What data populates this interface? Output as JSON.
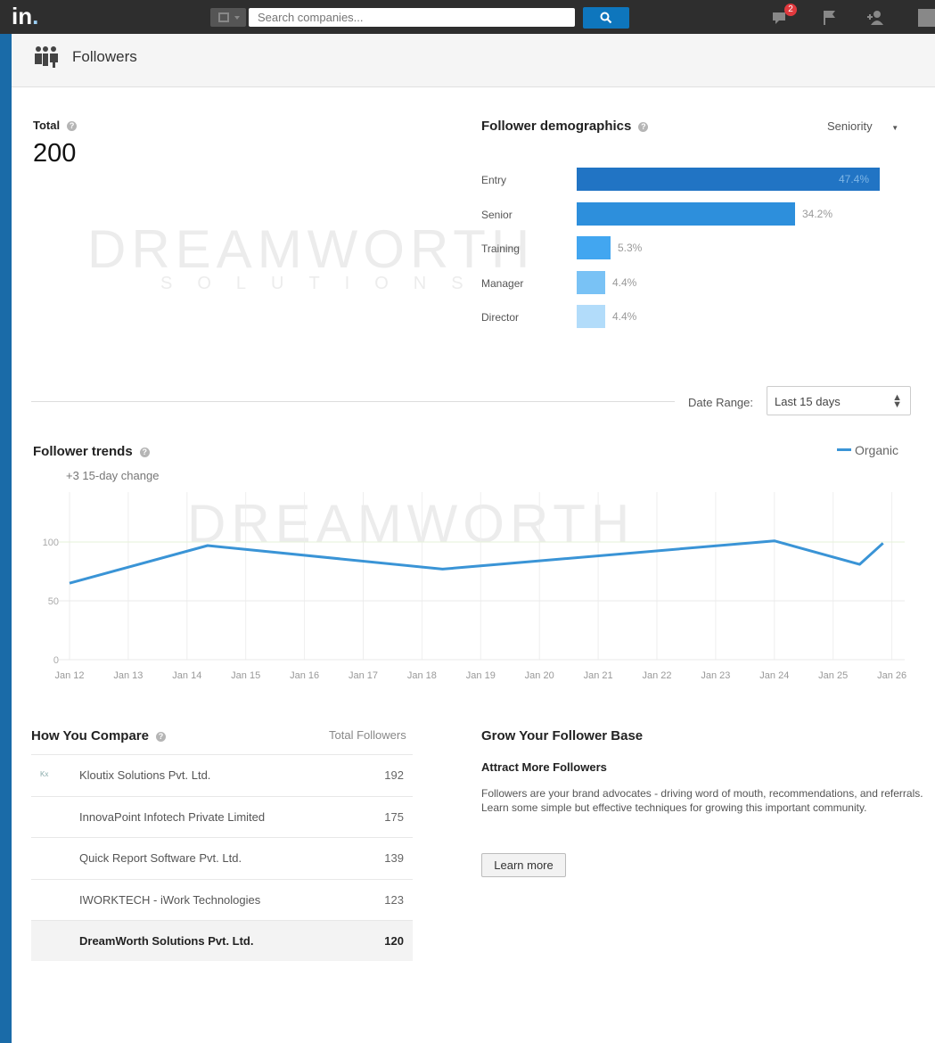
{
  "topbar": {
    "logo_text": "in",
    "search_placeholder": "Search companies...",
    "notification_count": "2"
  },
  "page": {
    "title": "Followers"
  },
  "watermark": {
    "brand": "DREAMWORTH",
    "tagline": "SOLUTIONS"
  },
  "total": {
    "label": "Total",
    "value": "200"
  },
  "demographics": {
    "title": "Follower demographics",
    "selected_filter": "Seniority",
    "rows": [
      {
        "label": "Entry",
        "value": 47.4,
        "display": "47.4%",
        "color": "#2174c4"
      },
      {
        "label": "Senior",
        "value": 34.2,
        "display": "34.2%",
        "color": "#2d8fdc"
      },
      {
        "label": "Training",
        "value": 5.3,
        "display": "5.3%",
        "color": "#42a6f0"
      },
      {
        "label": "Manager",
        "value": 4.4,
        "display": "4.4%",
        "color": "#79c2f5"
      },
      {
        "label": "Director",
        "value": 4.4,
        "display": "4.4%",
        "color": "#b2dcfa"
      }
    ]
  },
  "date_range": {
    "label": "Date Range:",
    "value": "Last 15 days"
  },
  "trends": {
    "title": "Follower trends",
    "change_note": "+3 15-day change",
    "legend_label": "Organic"
  },
  "chart_data": {
    "type": "line",
    "x": [
      "Jan 12",
      "Jan 13",
      "Jan 14",
      "Jan 15",
      "Jan 16",
      "Jan 17",
      "Jan 18",
      "Jan 19",
      "Jan 20",
      "Jan 21",
      "Jan 22",
      "Jan 23",
      "Jan 24",
      "Jan 25",
      "Jan 26"
    ],
    "yticks": [
      0,
      50,
      100
    ],
    "ylim": [
      0,
      110
    ],
    "series": [
      {
        "name": "Organic",
        "color": "#3a94d6",
        "points": [
          {
            "x": 12.0,
            "y": 65
          },
          {
            "x": 14.35,
            "y": 97
          },
          {
            "x": 18.35,
            "y": 77
          },
          {
            "x": 24.0,
            "y": 101
          },
          {
            "x": 25.45,
            "y": 81
          },
          {
            "x": 25.85,
            "y": 99
          }
        ]
      }
    ],
    "grid": true
  },
  "compare": {
    "title": "How You Compare",
    "column_header": "Total Followers",
    "rows": [
      {
        "name": "Kloutix Solutions Pvt. Ltd.",
        "count": "192",
        "logo_text": "Kx"
      },
      {
        "name": "InnovaPoint Infotech Private Limited",
        "count": "175",
        "logo_text": ""
      },
      {
        "name": "Quick Report Software Pvt. Ltd.",
        "count": "139",
        "logo_text": ""
      },
      {
        "name": "IWORKTECH - iWork Technologies",
        "count": "123",
        "logo_text": ""
      },
      {
        "name": "DreamWorth Solutions Pvt. Ltd.",
        "count": "120",
        "logo_text": ""
      }
    ]
  },
  "grow": {
    "title": "Grow Your Follower Base",
    "subtitle": "Attract More Followers",
    "body": "Followers are your brand advocates - driving word of mouth, recommendations, and referrals. Learn some simple but effective techniques for growing this important community.",
    "button_label": "Learn more"
  }
}
